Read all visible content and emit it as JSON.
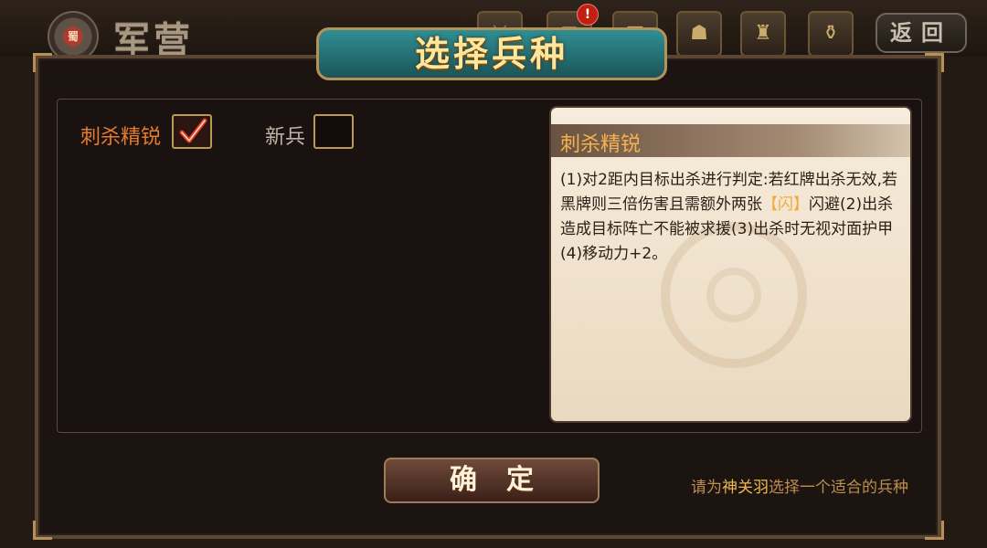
{
  "header": {
    "camp_title": "军营",
    "emblem_text": "蜀",
    "back_label": "返回",
    "alert_badge": "!",
    "top_icons": [
      "resource-icon",
      "scroll-icon",
      "chest-icon",
      "helmet-icon",
      "armor-icon",
      "treasure-icon"
    ]
  },
  "dialog": {
    "title": "选择兵种",
    "options": [
      {
        "label": "刺杀精锐",
        "checked": true
      },
      {
        "label": "新兵",
        "checked": false
      }
    ],
    "detail": {
      "name": "刺杀精锐",
      "text_part1": "(1)对2距内目标出杀进行判定:若红牌出杀无效,若黑牌则三倍伤害且需额外两张",
      "highlight": "【闪】",
      "text_part2": "闪避(2)出杀造成目标阵亡不能被求援(3)出杀时无视对面护甲(4)移动力+2。"
    },
    "confirm_label": "确定",
    "hint_prefix": "请为",
    "hint_hero": "神关羽",
    "hint_suffix": "选择一个适合的兵种"
  },
  "colors": {
    "selected": "#e67b2c",
    "highlight": "#f2a93b",
    "banner": "#2f8f93"
  }
}
